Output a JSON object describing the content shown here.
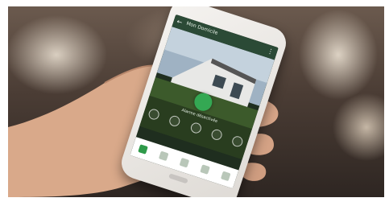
{
  "scene": {
    "description_colors": {
      "accent": "#34a853",
      "background_dark": "#2e2622",
      "phone_body": "#efece8"
    }
  },
  "phone_screen": {
    "title": "Mon Domicile",
    "mode_label": "Alarme désactivée",
    "nav_items": [
      "home-icon",
      "devices-icon",
      "scenario-icon",
      "camera-icon",
      "settings-icon"
    ],
    "quick_actions": [
      "action-1-icon",
      "action-2-icon",
      "action-3-icon",
      "action-4-icon",
      "action-5-icon",
      "action-6-icon"
    ]
  }
}
